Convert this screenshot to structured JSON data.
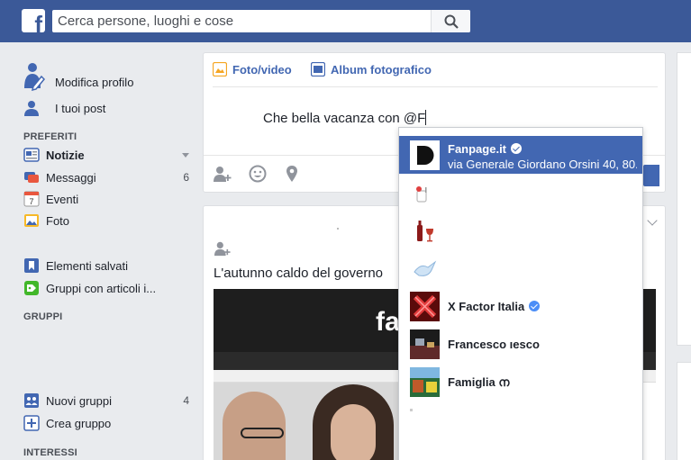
{
  "search": {
    "placeholder": "Cerca persone, luoghi e cose"
  },
  "sidebar": {
    "profile": [
      {
        "label": "Modifica profilo",
        "icon": "edit-profile-icon"
      },
      {
        "label": "I tuoi post",
        "icon": "user-icon"
      }
    ],
    "favorites_header": "PREFERITI",
    "favorites": [
      {
        "label": "Notizie",
        "icon": "news-feed-icon",
        "count": ""
      },
      {
        "label": "Messaggi",
        "icon": "messages-icon",
        "count": "6"
      },
      {
        "label": "Eventi",
        "icon": "calendar-icon",
        "count": ""
      },
      {
        "label": "Foto",
        "icon": "photos-icon",
        "count": ""
      }
    ],
    "saved": [
      {
        "label": "Elementi salvati",
        "icon": "bookmark-icon"
      },
      {
        "label": "Gruppi con articoli i...",
        "icon": "tag-icon"
      }
    ],
    "groups_header": "GRUPPI",
    "groups": [
      {
        "label": "Nuovi gruppi",
        "icon": "groups-icon",
        "count": "4"
      },
      {
        "label": "Crea gruppo",
        "icon": "plus-square-icon",
        "count": ""
      }
    ],
    "interests_header": "INTERESSI"
  },
  "composer": {
    "tab_photo": "Foto/video",
    "tab_album": "Album fotografico",
    "text": "Che bella vacanza con @F"
  },
  "post": {
    "title": "L'autunno caldo del governo",
    "image_brand": "fa"
  },
  "mention": {
    "items": [
      {
        "name": "Fanpage.it",
        "verified": true,
        "sub": "via Generale Giordano Orsini 40, 80...",
        "selected": true
      },
      {
        "name": "",
        "verified": false,
        "sub": "",
        "selected": false
      },
      {
        "name": "",
        "verified": false,
        "sub": "",
        "selected": false
      },
      {
        "name": "",
        "verified": false,
        "sub": "",
        "selected": false
      },
      {
        "name": "X Factor Italia",
        "verified": true,
        "sub": "",
        "selected": false
      },
      {
        "name": "Francesco ıesco",
        "verified": false,
        "sub": "",
        "selected": false
      },
      {
        "name": "Famiglia ന",
        "verified": false,
        "sub": "",
        "selected": false
      }
    ]
  },
  "colors": {
    "brand": "#3b5998",
    "accent": "#4267b2",
    "background": "#e9ebee"
  }
}
